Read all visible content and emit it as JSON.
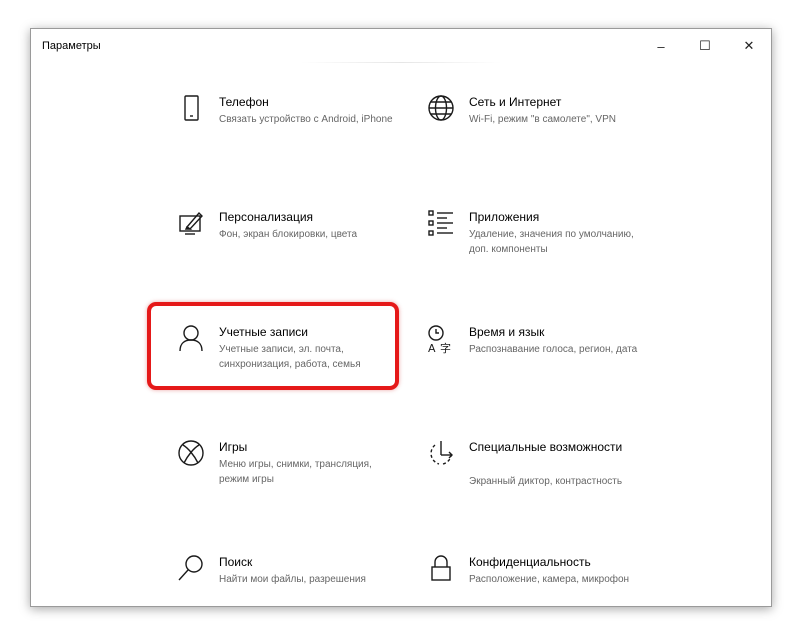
{
  "window": {
    "title": "Параметры",
    "minimize_glyph": "–",
    "maximize_glyph": "☐",
    "close_glyph": "✕"
  },
  "accent_color": "#e51919",
  "tiles": [
    {
      "icon": "phone-icon",
      "title": "Телефон",
      "desc": "Связать устройство с Android, iPhone"
    },
    {
      "icon": "globe-icon",
      "title": "Сеть и Интернет",
      "desc": "Wi-Fi, режим \"в самолете\", VPN"
    },
    {
      "icon": "personalization-icon",
      "title": "Персонализация",
      "desc": "Фон, экран блокировки, цвета"
    },
    {
      "icon": "apps-list-icon",
      "title": "Приложения",
      "desc": "Удаление, значения по умолчанию, доп. компоненты"
    },
    {
      "icon": "person-icon",
      "title": "Учетные записи",
      "desc": "Учетные записи, эл. почта, синхронизация, работа, семья",
      "highlighted": true
    },
    {
      "icon": "time-language-icon",
      "title": "Время и язык",
      "desc": "Распознавание голоса, регион, дата"
    },
    {
      "icon": "xbox-icon",
      "title": "Игры",
      "desc": "Меню игры, снимки, трансляция, режим игры"
    },
    {
      "icon": "ease-of-access-icon",
      "title": "Специальные возможности",
      "desc": "Экранный диктор, контрастность"
    },
    {
      "icon": "search-icon",
      "title": "Поиск",
      "desc": "Найти мои файлы, разрешения"
    },
    {
      "icon": "lock-icon",
      "title": "Конфиденциальность",
      "desc": "Расположение, камера, микрофон"
    }
  ]
}
